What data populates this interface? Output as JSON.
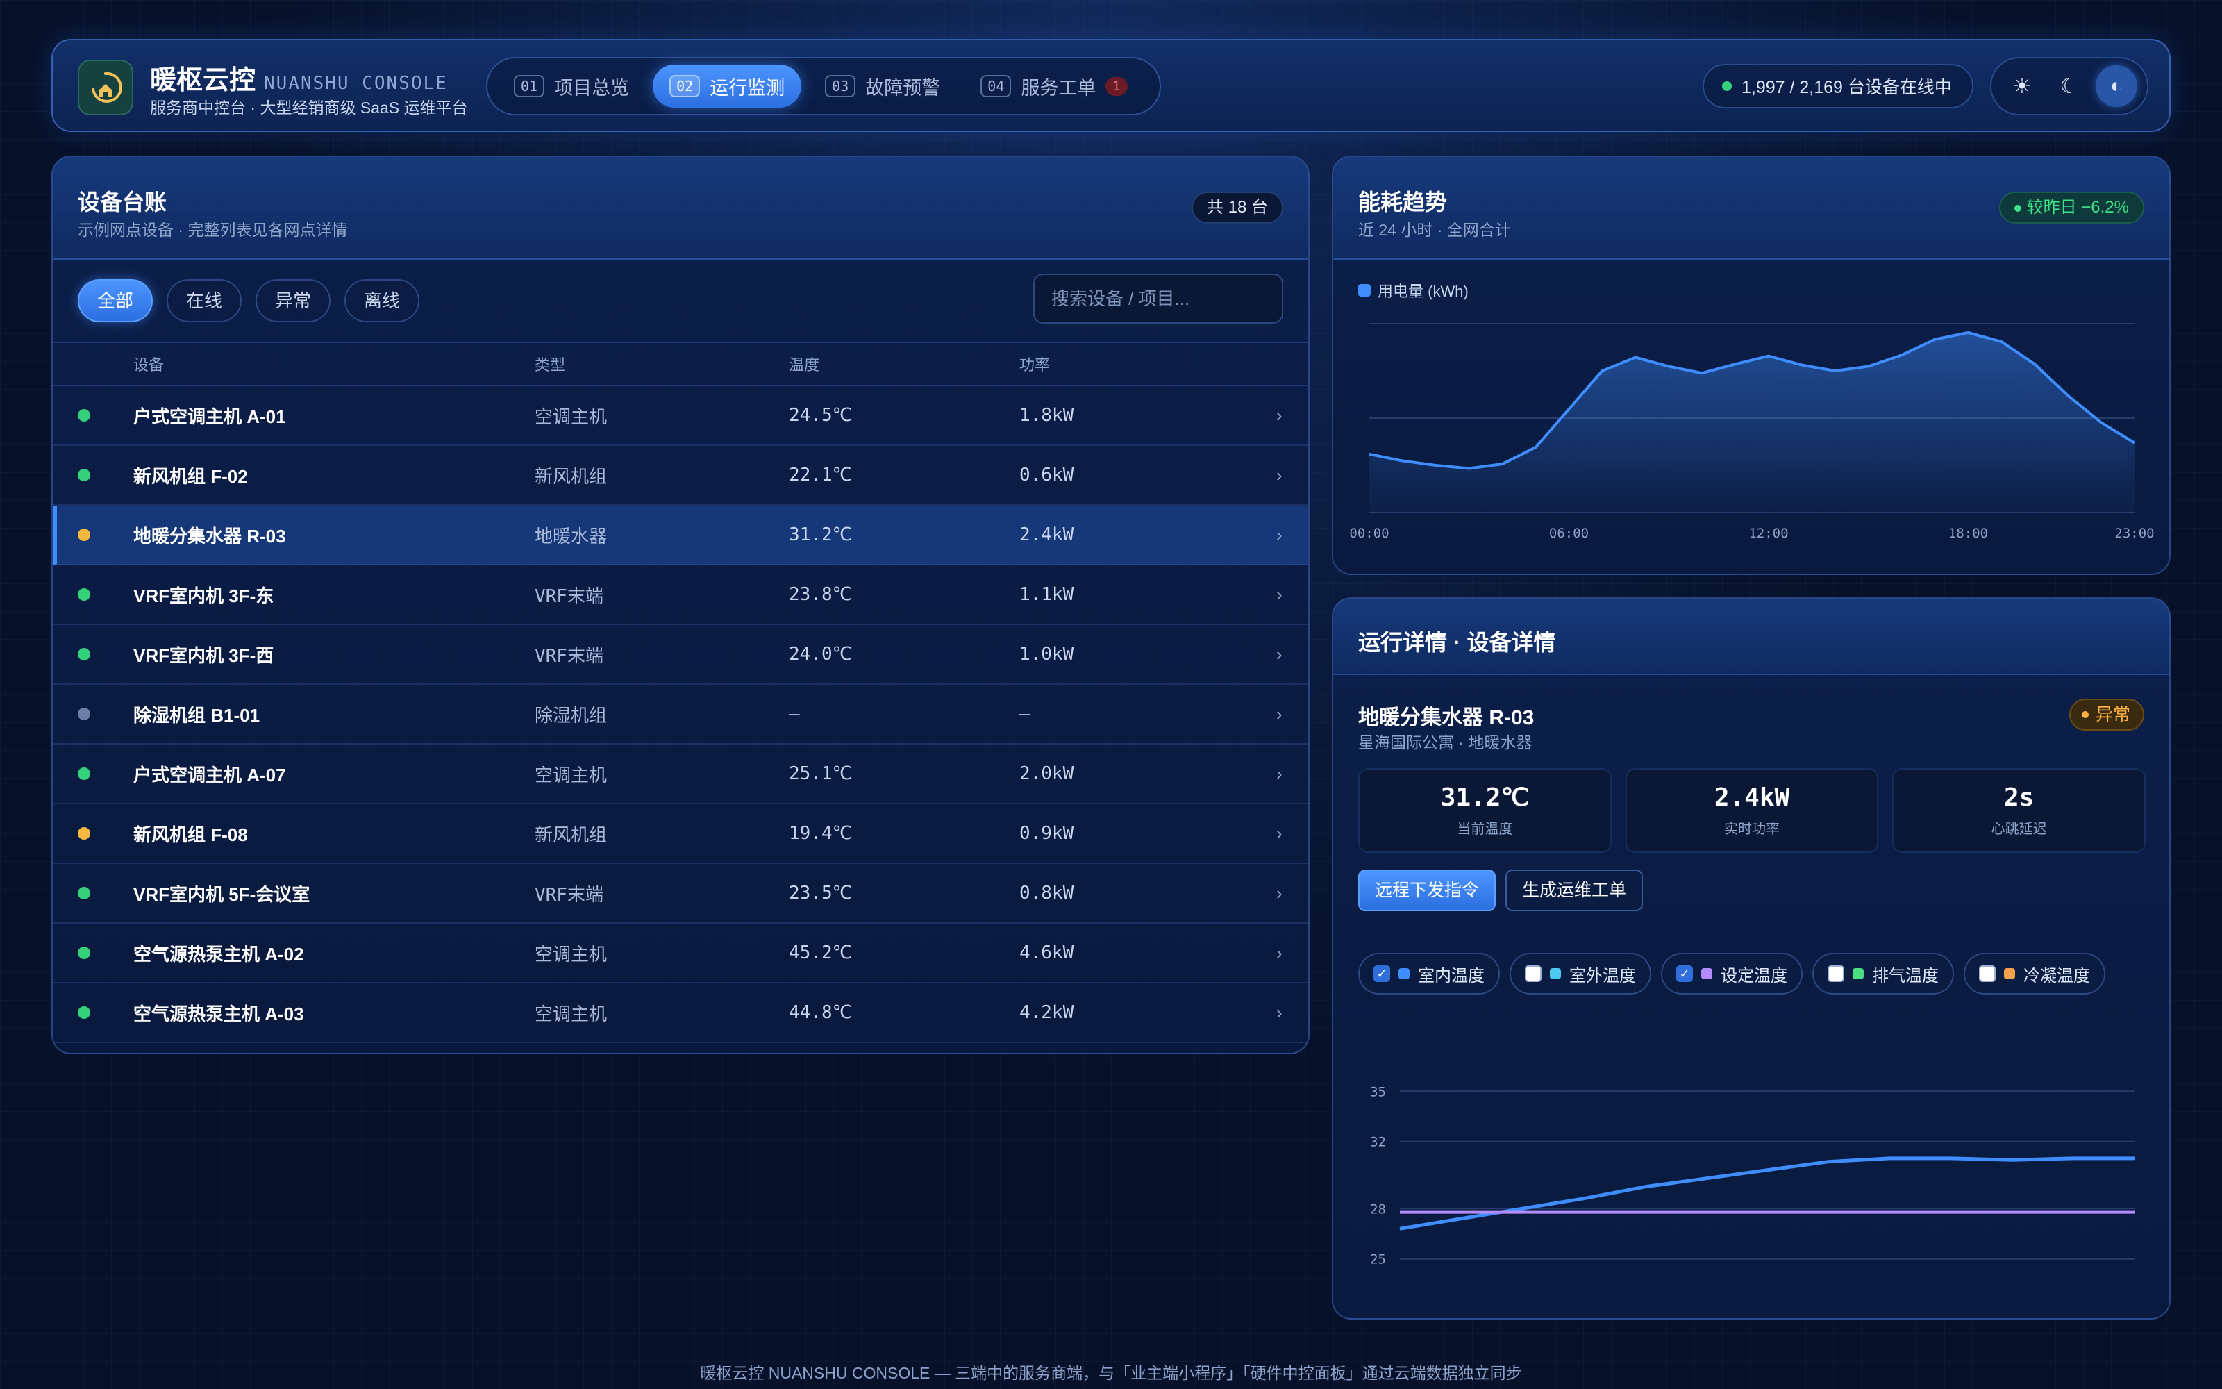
{
  "header": {
    "brand_cn": "暖枢云控",
    "brand_en": "NUANSHU CONSOLE",
    "subtitle": "服务商中控台 · 大型经销商级 SaaS 运维平台",
    "tabs": [
      {
        "num": "01",
        "label": "项目总览",
        "active": false
      },
      {
        "num": "02",
        "label": "运行监测",
        "active": true
      },
      {
        "num": "03",
        "label": "故障预警",
        "active": false
      },
      {
        "num": "04",
        "label": "服务工单",
        "active": false,
        "badge": "1"
      }
    ],
    "online_text": "1,997 / 2,169 台设备在线中",
    "theme_icons": [
      "sun-icon",
      "moon-icon",
      "contrast-icon"
    ]
  },
  "ledger": {
    "title": "设备台账",
    "subtitle": "示例网点设备 · 完整列表见各网点详情",
    "count": "共 18 台",
    "filters": [
      "全部",
      "在线",
      "异常",
      "离线"
    ],
    "search_placeholder": "搜索设备 / 项目...",
    "columns": [
      "设备",
      "类型",
      "温度",
      "功率"
    ],
    "rows": [
      {
        "status": "online",
        "name": "户式空调主机 A-01",
        "type": "空调主机",
        "temp": "24.5℃",
        "power": "1.8kW"
      },
      {
        "status": "online",
        "name": "新风机组 F-02",
        "type": "新风机组",
        "temp": "22.1℃",
        "power": "0.6kW"
      },
      {
        "status": "warning",
        "name": "地暖分集水器 R-03",
        "type": "地暖水器",
        "temp": "31.2℃",
        "power": "2.4kW",
        "selected": true
      },
      {
        "status": "online",
        "name": "VRF室内机 3F-东",
        "type": "VRF末端",
        "temp": "23.8℃",
        "power": "1.1kW"
      },
      {
        "status": "online",
        "name": "VRF室内机 3F-西",
        "type": "VRF末端",
        "temp": "24.0℃",
        "power": "1.0kW"
      },
      {
        "status": "offline",
        "name": "除湿机组 B1-01",
        "type": "除湿机组",
        "temp": "—",
        "power": "—"
      },
      {
        "status": "online",
        "name": "户式空调主机 A-07",
        "type": "空调主机",
        "temp": "25.1℃",
        "power": "2.0kW"
      },
      {
        "status": "warning",
        "name": "新风机组 F-08",
        "type": "新风机组",
        "temp": "19.4℃",
        "power": "0.9kW"
      },
      {
        "status": "online",
        "name": "VRF室内机 5F-会议室",
        "type": "VRF末端",
        "temp": "23.5℃",
        "power": "0.8kW"
      },
      {
        "status": "online",
        "name": "空气源热泵主机 A-02",
        "type": "空调主机",
        "temp": "45.2℃",
        "power": "4.6kW"
      },
      {
        "status": "online",
        "name": "空气源热泵主机 A-03",
        "type": "空调主机",
        "temp": "44.8℃",
        "power": "4.2kW"
      }
    ],
    "arrow": "›"
  },
  "colors": {
    "online": "#34d17a",
    "warning": "#f5b942",
    "offline": "#6b7fa6",
    "accent": "#3f8dff"
  },
  "energy": {
    "title": "能耗趋势",
    "subtitle": "近 24 小时 · 全网合计",
    "delta": "较昨日 −6.2%",
    "legend": "用电量 (kWh)"
  },
  "detail": {
    "title": "运行详情 · 设备详情",
    "device_name": "地暖分集水器 R-03",
    "device_sub": "星海国际公寓 · 地暖水器",
    "status": "异常",
    "stats": [
      {
        "value": "31.2℃",
        "label": "当前温度"
      },
      {
        "value": "2.4kW",
        "label": "实时功率"
      },
      {
        "value": "2s",
        "label": "心跳延迟"
      }
    ],
    "actions": [
      "远程下发指令",
      "生成运维工单"
    ],
    "series_toggles": [
      {
        "label": "室内温度",
        "checked": true,
        "color": "#3f8dff"
      },
      {
        "label": "室外温度",
        "checked": false,
        "color": "#4cc9f0"
      },
      {
        "label": "设定温度",
        "checked": true,
        "color": "#b48cff"
      },
      {
        "label": "排气温度",
        "checked": false,
        "color": "#4ade80"
      },
      {
        "label": "冷凝温度",
        "checked": false,
        "color": "#f5a04a"
      }
    ]
  },
  "chart_data": [
    {
      "type": "area",
      "x": [
        "00:00",
        "01:00",
        "02:00",
        "03:00",
        "04:00",
        "05:00",
        "06:00",
        "07:00",
        "08:00",
        "09:00",
        "10:00",
        "11:00",
        "12:00",
        "13:00",
        "14:00",
        "15:00",
        "16:00",
        "17:00",
        "18:00",
        "19:00",
        "20:00",
        "21:00",
        "22:00",
        "23:00"
      ],
      "xticks": [
        "00:00",
        "06:00",
        "12:00",
        "18:00",
        "23:00"
      ],
      "series": [
        {
          "name": "用电量 (kWh)",
          "values": [
            1.3,
            1.15,
            1.05,
            0.98,
            1.08,
            1.45,
            2.3,
            3.15,
            3.45,
            3.25,
            3.1,
            3.3,
            3.48,
            3.28,
            3.15,
            3.25,
            3.5,
            3.85,
            4.0,
            3.8,
            3.3,
            2.6,
            2.0,
            1.55
          ]
        }
      ],
      "ylim": [
        0,
        4.2
      ],
      "grid": true
    },
    {
      "type": "line",
      "x": [
        0,
        1,
        2,
        3,
        4,
        5,
        6,
        7,
        8,
        9,
        10,
        11,
        12
      ],
      "yticks": [
        25,
        28,
        32,
        35
      ],
      "ylim": [
        24.2,
        35.8
      ],
      "series": [
        {
          "name": "室内温度",
          "color": "#3f8dff",
          "values": [
            26.8,
            27.4,
            28.0,
            28.6,
            29.3,
            29.8,
            30.3,
            30.8,
            31.0,
            31.0,
            30.9,
            31.0,
            31.0
          ]
        },
        {
          "name": "设定温度",
          "color": "#b48cff",
          "values": [
            27.8,
            27.8,
            27.8,
            27.8,
            27.8,
            27.8,
            27.8,
            27.8,
            27.8,
            27.8,
            27.8,
            27.8,
            27.8
          ]
        }
      ],
      "grid": true
    }
  ],
  "footer": "暖枢云控 NUANSHU CONSOLE — 三端中的服务商端，与「业主端小程序」「硬件中控面板」通过云端数据独立同步"
}
